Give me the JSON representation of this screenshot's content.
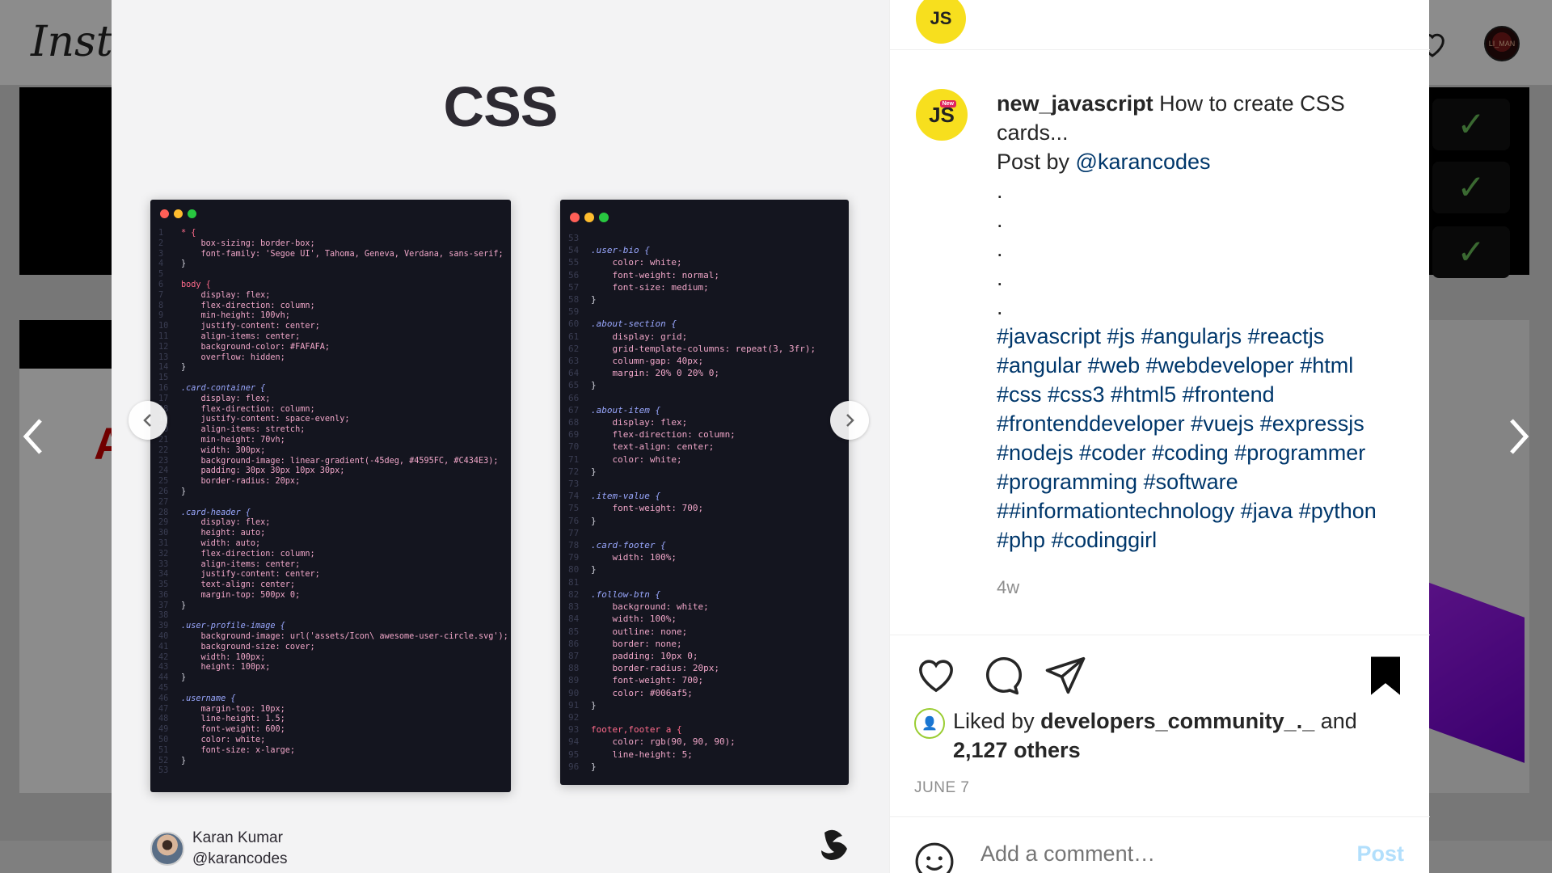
{
  "background": {
    "logo": "Instagram",
    "avatar_text": "LI_MAN",
    "red_letter": "A",
    "checks": [
      "✓",
      "✓",
      "✓"
    ]
  },
  "slide": {
    "title": "CSS",
    "author_name": "Karan Kumar",
    "author_handle": "@karancodes",
    "left_code": [
      "* {",
      "    box-sizing: border-box;",
      "    font-family: 'Segoe UI', Tahoma, Geneva, Verdana, sans-serif;",
      "}",
      "",
      "body {",
      "    display: flex;",
      "    flex-direction: column;",
      "    min-height: 100vh;",
      "    justify-content: center;",
      "    align-items: center;",
      "    background-color: #FAFAFA;",
      "    overflow: hidden;",
      "}",
      "",
      ".card-container {",
      "    display: flex;",
      "    flex-direction: column;",
      "    justify-content: space-evenly;",
      "    align-items: stretch;",
      "    min-height: 70vh;",
      "    width: 300px;",
      "    background-image: linear-gradient(-45deg, #4595FC, #C434E3);",
      "    padding: 30px 30px 10px 30px;",
      "    border-radius: 20px;",
      "}",
      "",
      ".card-header {",
      "    display: flex;",
      "    height: auto;",
      "    width: auto;",
      "    flex-direction: column;",
      "    align-items: center;",
      "    justify-content: center;",
      "    text-align: center;",
      "    margin-top: 500px 0;",
      "}",
      "",
      ".user-profile-image {",
      "    background-image: url('assets/Icon\\ awesome-user-circle.svg');",
      "    background-size: cover;",
      "    width: 100px;",
      "    height: 100px;",
      "}",
      "",
      ".username {",
      "    margin-top: 10px;",
      "    line-height: 1.5;",
      "    font-weight: 600;",
      "    color: white;",
      "    font-size: x-large;",
      "}",
      ""
    ],
    "right_code": [
      "",
      ".user-bio {",
      "    color: white;",
      "    font-weight: normal;",
      "    font-size: medium;",
      "}",
      "",
      ".about-section {",
      "    display: grid;",
      "    grid-template-columns: repeat(3, 3fr);",
      "    column-gap: 40px;",
      "    margin: 20% 0 20% 0;",
      "}",
      "",
      ".about-item {",
      "    display: flex;",
      "    flex-direction: column;",
      "    text-align: center;",
      "    color: white;",
      "}",
      "",
      ".item-value {",
      "    font-weight: 700;",
      "}",
      "",
      ".card-footer {",
      "    width: 100%;",
      "}",
      "",
      ".follow-btn {",
      "    background: white;",
      "    width: 100%;",
      "    outline: none;",
      "    border: none;",
      "    padding: 10px 0;",
      "    border-radius: 20px;",
      "    font-weight: 700;",
      "    color: #006af5;",
      "}",
      "",
      "footer,footer a {",
      "    color: rgb(90, 90, 90);",
      "    line-height: 5;",
      "}"
    ],
    "right_code_start": 53
  },
  "post": {
    "username": "new_javascript",
    "caption_text": " How to create CSS cards...",
    "post_by": "Post by ",
    "mention": "@karancodes",
    "dots": [
      ".",
      ".",
      ".",
      ".",
      "."
    ],
    "hashtags": "#javascript #js #angularjs #reactjs #angular #web #webdeveloper #html #css #css3 #html5 #frontend #frontenddeveloper #vuejs #expressjs #nodejs #coder #coding #programmer #programming #software ##informationtechnology #java #python #php #codinggirl",
    "age": "4w",
    "badge_text": "JS",
    "badge_new": "New"
  },
  "likes": {
    "prefix": "Liked by ",
    "liker": "developers_community_._",
    "middle": " and ",
    "others": "2,127 others"
  },
  "date": "JUNE 7",
  "comment": {
    "placeholder": "Add a comment…",
    "post_label": "Post"
  },
  "colors": {
    "link": "#00376b",
    "js_yellow": "#f7df1e",
    "post_disabled": "#b2dffc"
  },
  "icons": [
    "heart-icon",
    "comment-icon",
    "share-icon",
    "bookmark-icon",
    "emoji-icon",
    "chevron-left-icon",
    "chevron-right-icon"
  ]
}
